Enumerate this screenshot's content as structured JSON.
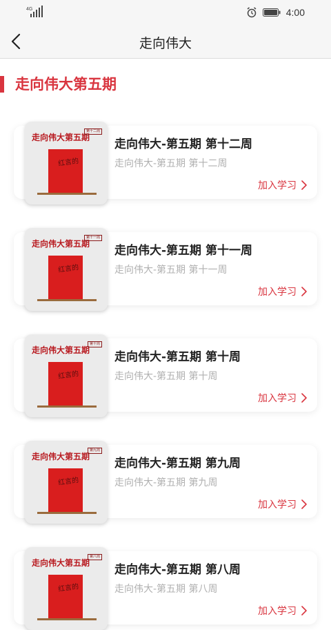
{
  "status_bar": {
    "network": "4G",
    "time": "4:00",
    "icons": [
      "signal-icon",
      "alarm-icon",
      "battery-icon"
    ]
  },
  "nav": {
    "title": "走向伟大",
    "back_icon": "chevron-left-icon"
  },
  "section": {
    "title": "走向伟大第五期"
  },
  "thumbnail": {
    "cover_title": "走向伟大第五期",
    "book_text": "红言的"
  },
  "courses": [
    {
      "cover_tag": "第十二周",
      "title": "走向伟大-第五期 第十二周",
      "subtitle": "走向伟大-第五期 第十二周",
      "action": "加入学习"
    },
    {
      "cover_tag": "第十一周",
      "title": "走向伟大-第五期 第十一周",
      "subtitle": "走向伟大-第五期 第十一周",
      "action": "加入学习"
    },
    {
      "cover_tag": "第十周",
      "title": "走向伟大-第五期 第十周",
      "subtitle": "走向伟大-第五期 第十周",
      "action": "加入学习"
    },
    {
      "cover_tag": "第九周",
      "title": "走向伟大-第五期 第九周",
      "subtitle": "走向伟大-第五期 第九周",
      "action": "加入学习"
    },
    {
      "cover_tag": "第八周",
      "title": "走向伟大-第五期 第八周",
      "subtitle": "走向伟大-第五期 第八周",
      "action": "加入学习"
    }
  ],
  "colors": {
    "accent": "#d9353f",
    "title_text": "#222222",
    "subtitle_text": "#b0b0b0",
    "bar_background": "#f6f6f6"
  }
}
